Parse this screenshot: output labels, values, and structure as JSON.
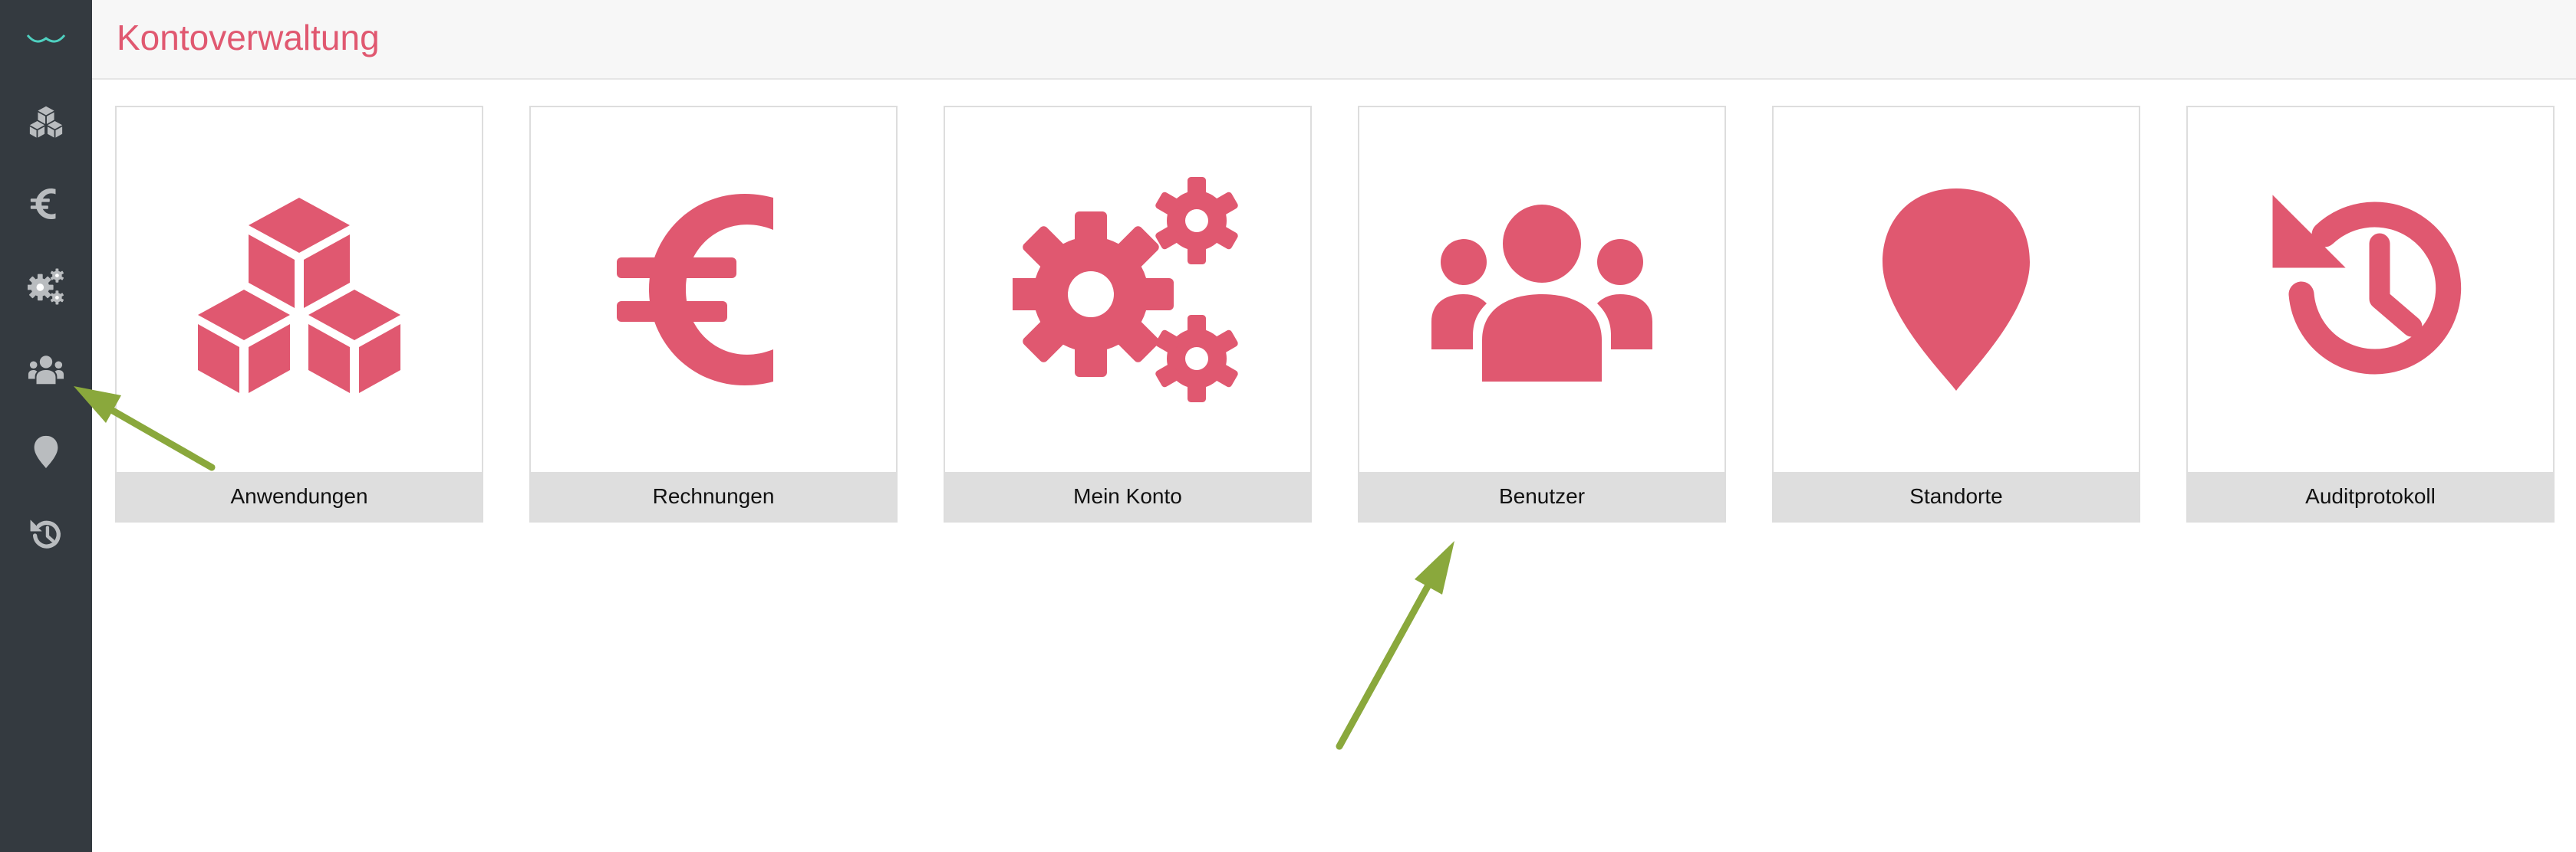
{
  "colors": {
    "accent": "#e05870",
    "sidebar_bg": "#343a40",
    "sidebar_icon": "#b9bcbf",
    "logo": "#4fd0c0",
    "tile_label_bg": "#dedede",
    "annotation_arrow": "#8aa83c"
  },
  "header": {
    "title": "Kontoverwaltung"
  },
  "sidebar": {
    "logo": "logo-icon",
    "items": [
      {
        "name": "anwendungen",
        "icon": "cubes-icon"
      },
      {
        "name": "rechnungen",
        "icon": "euro-icon"
      },
      {
        "name": "mein-konto",
        "icon": "gears-icon"
      },
      {
        "name": "benutzer",
        "icon": "users-icon"
      },
      {
        "name": "standorte",
        "icon": "location-pin-icon"
      },
      {
        "name": "auditprotokoll",
        "icon": "history-icon"
      }
    ]
  },
  "tiles": [
    {
      "label": "Anwendungen",
      "icon": "cubes-icon"
    },
    {
      "label": "Rechnungen",
      "icon": "euro-icon"
    },
    {
      "label": "Mein Konto",
      "icon": "gears-icon"
    },
    {
      "label": "Benutzer",
      "icon": "users-icon"
    },
    {
      "label": "Standorte",
      "icon": "location-pin-icon"
    },
    {
      "label": "Auditprotokoll",
      "icon": "history-icon"
    }
  ]
}
